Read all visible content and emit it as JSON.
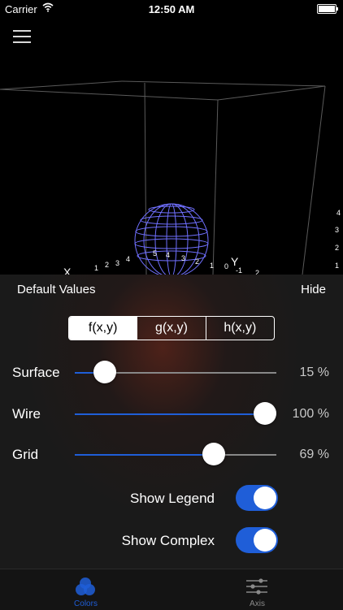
{
  "status_bar": {
    "carrier": "Carrier",
    "time": "12:50 AM"
  },
  "plot": {
    "axis_x_label": "X",
    "axis_y_label": "Y",
    "ticks_x": [
      "1",
      "2",
      "3",
      "4"
    ],
    "ticks_surface": [
      "5",
      "4",
      "3",
      "2",
      "1"
    ],
    "ticks_y": [
      "0",
      "-1",
      "2"
    ],
    "ticks_right": [
      "4",
      "3",
      "2",
      "1"
    ]
  },
  "panel": {
    "title": "Default Values",
    "hide_label": "Hide",
    "functions": [
      "f(x,y)",
      "g(x,y)",
      "h(x,y)"
    ],
    "selected_function": "f(x,y)",
    "sliders": [
      {
        "label": "Surface",
        "value": 0.15,
        "percent_text": "15 %"
      },
      {
        "label": "Wire",
        "value": 1.0,
        "percent_text": "100 %"
      },
      {
        "label": "Grid",
        "value": 0.69,
        "percent_text": "69 %"
      }
    ],
    "toggles": [
      {
        "label": "Show Legend",
        "on": true
      },
      {
        "label": "Show Complex",
        "on": true
      }
    ]
  },
  "tabbar": {
    "tabs": [
      {
        "label": "Colors",
        "icon": "colors-icon",
        "selected": true
      },
      {
        "label": "Axis",
        "icon": "axis-sliders-icon",
        "selected": false
      }
    ]
  },
  "colors": {
    "accent": "#1f5ed8",
    "wire": "#7070ff",
    "background": "#000000",
    "panel": "#1a1a1a"
  }
}
